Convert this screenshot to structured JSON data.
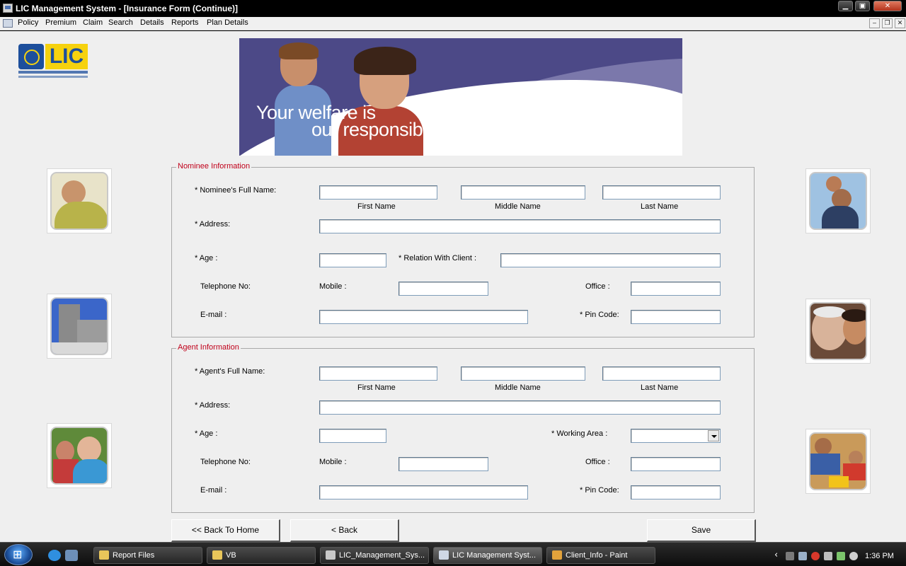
{
  "window": {
    "title": "LIC Management System - [Insurance Form (Continue)]",
    "min": "▁",
    "max": "▣",
    "close": "✕"
  },
  "menu": {
    "items": [
      "Policy",
      "Premium",
      "Claim",
      "Search",
      "Details",
      "Reports",
      "Plan Details"
    ],
    "mdi_min": "–",
    "mdi_restore": "❐",
    "mdi_close": "✕"
  },
  "logo": {
    "text": "LIC"
  },
  "banner": {
    "line1": "Your welfare is",
    "line2": "our responsibility"
  },
  "nominee": {
    "legend": "Nominee Information",
    "full_name_label": "* Nominee's Full Name:",
    "first_name_caption": "First Name",
    "middle_name_caption": "Middle Name",
    "last_name_caption": "Last Name",
    "address_label": "* Address:",
    "age_label": "* Age :",
    "relation_label": "* Relation With Client :",
    "telephone_label": "Telephone No:",
    "mobile_label": "Mobile :",
    "office_label": "Office :",
    "email_label": "E-mail :",
    "pincode_label": "* Pin Code:",
    "values": {
      "first": "",
      "middle": "",
      "last": "",
      "address": "",
      "age": "",
      "relation": "",
      "mobile": "",
      "office": "",
      "email": "",
      "pincode": ""
    }
  },
  "agent": {
    "legend": "Agent Information",
    "full_name_label": "* Agent's Full Name:",
    "first_name_caption": "First Name",
    "middle_name_caption": "Middle Name",
    "last_name_caption": "Last Name",
    "address_label": "* Address:",
    "age_label": "* Age :",
    "working_area_label": "* Working  Area :",
    "telephone_label": "Telephone No:",
    "mobile_label": "Mobile :",
    "office_label": "Office :",
    "email_label": "E-mail :",
    "pincode_label": "* Pin Code:",
    "values": {
      "first": "",
      "middle": "",
      "last": "",
      "address": "",
      "age": "",
      "working_area": "",
      "mobile": "",
      "office": "",
      "email": "",
      "pincode": ""
    }
  },
  "buttons": {
    "back_to_home": "<< Back To Home",
    "back": "< Back",
    "save": "Save"
  },
  "taskbar": {
    "tasks": [
      "Report Files",
      "VB",
      "LIC_Management_Sys...",
      "LIC Management Syst...",
      "Client_Info - Paint"
    ],
    "clock": "1:36 PM",
    "tray_chevron": "‹"
  }
}
